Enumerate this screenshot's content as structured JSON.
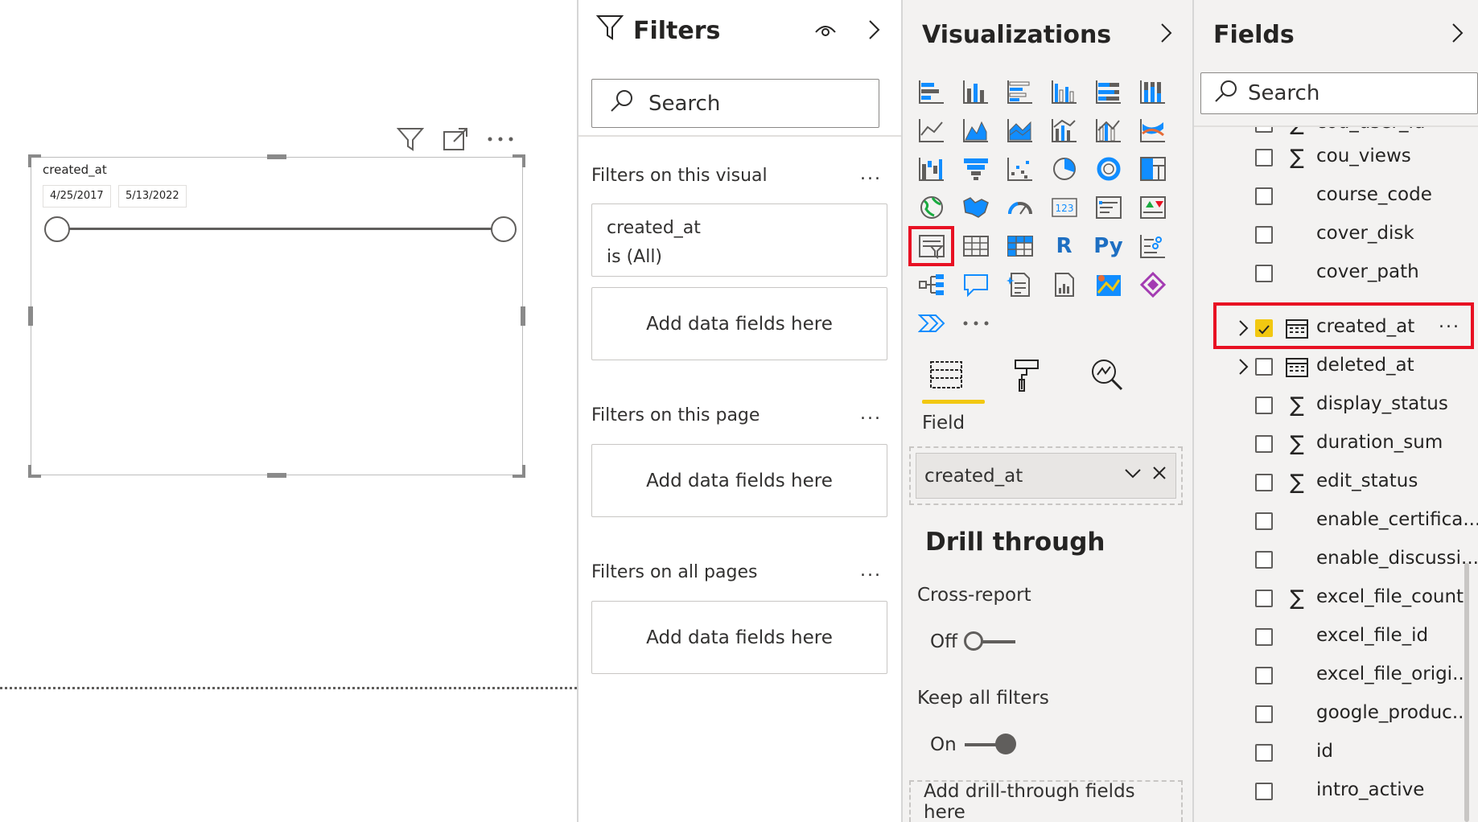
{
  "slicer": {
    "title": "created_at",
    "start_date": "4/25/2017",
    "end_date": "5/13/2022"
  },
  "filters": {
    "title": "Filters",
    "search_placeholder": "Search",
    "visual_section": "Filters on this visual",
    "filter_card_field": "created_at",
    "filter_card_state": "is (All)",
    "add_fields": "Add data fields here",
    "page_section": "Filters on this page",
    "all_section": "Filters on all pages",
    "more": "..."
  },
  "visualizations": {
    "title": "Visualizations",
    "field_label": "Field",
    "field_value": "created_at",
    "drill_title": "Drill through",
    "cross_report": "Cross-report",
    "cross_report_state": "Off",
    "keep_filters": "Keep all filters",
    "keep_filters_state": "On",
    "drill_well": "Add drill-through fields here",
    "more": "...",
    "r_label": "R",
    "py_label": "Py",
    "card_label": "123"
  },
  "fields": {
    "title": "Fields",
    "search_placeholder": "Search",
    "items": [
      {
        "name": "cou_user_id",
        "type": "sum",
        "checked": false
      },
      {
        "name": "cou_views",
        "type": "sum",
        "checked": false
      },
      {
        "name": "course_code",
        "type": "text",
        "checked": false
      },
      {
        "name": "cover_disk",
        "type": "text",
        "checked": false
      },
      {
        "name": "cover_path",
        "type": "text",
        "checked": false
      },
      {
        "name": "created_at",
        "type": "date",
        "checked": true
      },
      {
        "name": "deleted_at",
        "type": "date",
        "checked": false
      },
      {
        "name": "display_status",
        "type": "sum",
        "checked": false
      },
      {
        "name": "duration_sum",
        "type": "sum",
        "checked": false
      },
      {
        "name": "edit_status",
        "type": "sum",
        "checked": false
      },
      {
        "name": "enable_certifica...",
        "type": "text",
        "checked": false
      },
      {
        "name": "enable_discussi...",
        "type": "text",
        "checked": false
      },
      {
        "name": "excel_file_count",
        "type": "sum",
        "checked": false
      },
      {
        "name": "excel_file_id",
        "type": "text",
        "checked": false
      },
      {
        "name": "excel_file_origi...",
        "type": "text",
        "checked": false
      },
      {
        "name": "google_produc...",
        "type": "text",
        "checked": false
      },
      {
        "name": "id",
        "type": "text",
        "checked": false
      },
      {
        "name": "intro_active",
        "type": "text",
        "checked": false
      }
    ],
    "more": "..."
  },
  "colors": {
    "accent": "#f2c811",
    "highlight": "#e81123"
  }
}
